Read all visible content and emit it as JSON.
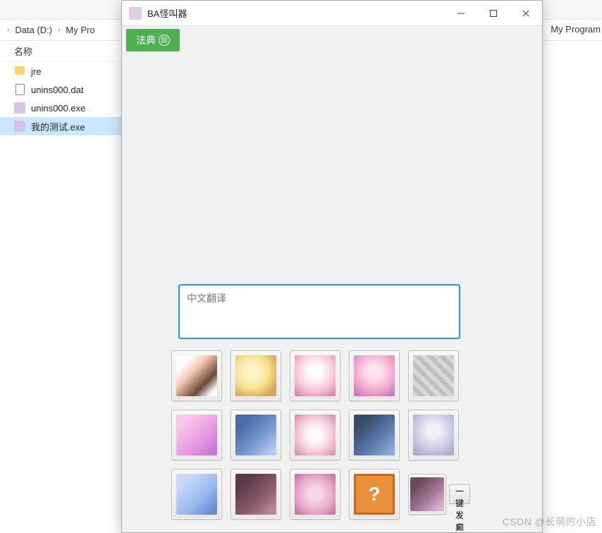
{
  "explorer": {
    "breadcrumb": [
      "Data (D:)",
      "My Pro"
    ],
    "right_fragment": "My Program",
    "column_header": "名称",
    "files": [
      {
        "name": "jre",
        "type": "folder",
        "selected": false
      },
      {
        "name": "unins000.dat",
        "type": "file",
        "selected": false
      },
      {
        "name": "unins000.exe",
        "type": "exe",
        "selected": false
      },
      {
        "name": "我的测试.exe",
        "type": "exe",
        "selected": true
      }
    ]
  },
  "app": {
    "title": "BA怪叫器",
    "green_button": "法典",
    "input_placeholder": "中文翻译",
    "question_mark": "?",
    "side_button": "一键发癫"
  },
  "watermark": "CSDN @长萌的小店"
}
